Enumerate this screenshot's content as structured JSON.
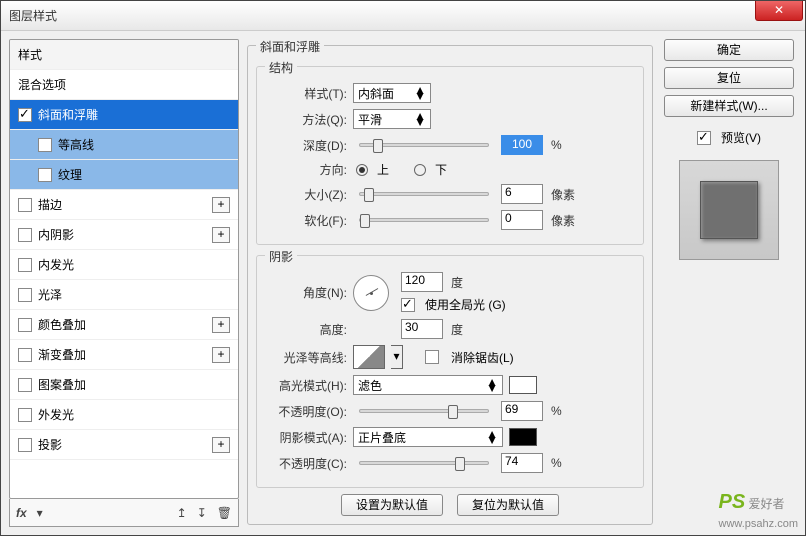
{
  "window": {
    "title": "图层样式",
    "close": "✕"
  },
  "sidebar": {
    "header": "样式",
    "blend": "混合选项",
    "items": [
      {
        "label": "斜面和浮雕",
        "checked": true,
        "selected": "sel"
      },
      {
        "label": "等高线",
        "checked": false,
        "selected": "sub-sel",
        "sub": true
      },
      {
        "label": "纹理",
        "checked": false,
        "selected": "sub-sel",
        "sub": true
      },
      {
        "label": "描边",
        "checked": false,
        "plus": true
      },
      {
        "label": "内阴影",
        "checked": false,
        "plus": true
      },
      {
        "label": "内发光",
        "checked": false
      },
      {
        "label": "光泽",
        "checked": false
      },
      {
        "label": "颜色叠加",
        "checked": false,
        "plus": true
      },
      {
        "label": "渐变叠加",
        "checked": false,
        "plus": true
      },
      {
        "label": "图案叠加",
        "checked": false
      },
      {
        "label": "外发光",
        "checked": false
      },
      {
        "label": "投影",
        "checked": false,
        "plus": true
      }
    ],
    "footer": {
      "fx": "fx",
      "plus": "+"
    }
  },
  "panel": {
    "title": "斜面和浮雕",
    "structure": {
      "title": "结构",
      "style_label": "样式(T):",
      "style_value": "内斜面",
      "technique_label": "方法(Q):",
      "technique_value": "平滑",
      "depth_label": "深度(D):",
      "depth_value": "100",
      "depth_unit": "%",
      "direction_label": "方向:",
      "up": "上",
      "down": "下",
      "size_label": "大小(Z):",
      "size_value": "6",
      "size_unit": "像素",
      "soften_label": "软化(F):",
      "soften_value": "0",
      "soften_unit": "像素"
    },
    "shading": {
      "title": "阴影",
      "angle_label": "角度(N):",
      "angle_value": "120",
      "angle_unit": "度",
      "global_light": "使用全局光 (G)",
      "altitude_label": "高度:",
      "altitude_value": "30",
      "altitude_unit": "度",
      "gloss_label": "光泽等高线:",
      "antialias": "消除锯齿(L)",
      "highlight_mode_label": "高光模式(H):",
      "highlight_mode_value": "滤色",
      "highlight_opacity_label": "不透明度(O):",
      "highlight_opacity_value": "69",
      "opacity_unit": "%",
      "shadow_mode_label": "阴影模式(A):",
      "shadow_mode_value": "正片叠底",
      "shadow_opacity_label": "不透明度(C):",
      "shadow_opacity_value": "74",
      "highlight_color": "#ffffff",
      "shadow_color": "#000000"
    },
    "buttons": {
      "make_default": "设置为默认值",
      "reset_default": "复位为默认值"
    }
  },
  "right": {
    "ok": "确定",
    "cancel": "复位",
    "new_style": "新建样式(W)...",
    "preview_label": "预览(V)"
  },
  "watermark": {
    "brand": "PS",
    "text": " 爱好者",
    "url": "www.psahz.com"
  }
}
